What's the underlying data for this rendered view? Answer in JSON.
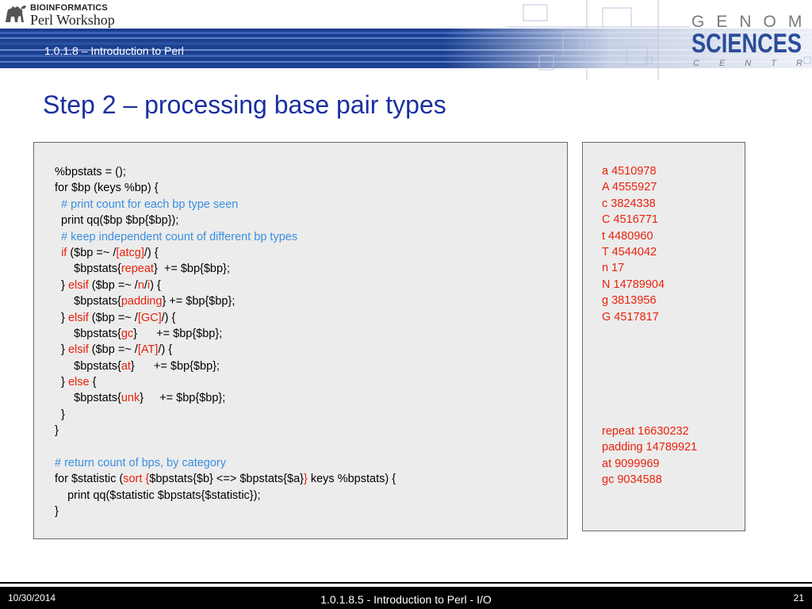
{
  "header": {
    "logo_top": "BIOINFORMATICS",
    "logo_bottom": "Perl Workshop",
    "section_title": "1.0.1.8 – Introduction to Perl",
    "gsc_line1": "GENOME",
    "gsc_line2": "SCIENCES",
    "gsc_line3": "CENTRE"
  },
  "slide": {
    "title": "Step 2 – processing base pair types"
  },
  "code": {
    "lines": [
      [
        {
          "t": "%bpstats = ();",
          "c": "n"
        }
      ],
      [
        {
          "t": "for $bp (keys %bp) {",
          "c": "n"
        }
      ],
      [
        {
          "t": "  # print count for each bp type seen",
          "c": "cm"
        }
      ],
      [
        {
          "t": "  print qq($bp $bp{$bp});",
          "c": "n"
        }
      ],
      [
        {
          "t": "  # keep independent count of different bp types",
          "c": "cm"
        }
      ],
      [
        {
          "t": "  ",
          "c": "n"
        },
        {
          "t": "if",
          "c": "kw"
        },
        {
          "t": " ($bp =~ /",
          "c": "n"
        },
        {
          "t": "[atcg]",
          "c": "kw"
        },
        {
          "t": "/) {",
          "c": "n"
        }
      ],
      [
        {
          "t": "      $bpstats{",
          "c": "n"
        },
        {
          "t": "repeat",
          "c": "kw"
        },
        {
          "t": "}  += $bp{$bp};",
          "c": "n"
        }
      ],
      [
        {
          "t": "  } ",
          "c": "n"
        },
        {
          "t": "elsif",
          "c": "kw"
        },
        {
          "t": " ($bp =~ /",
          "c": "n"
        },
        {
          "t": "n",
          "c": "kw"
        },
        {
          "t": "/",
          "c": "n"
        },
        {
          "t": "i",
          "c": "kw"
        },
        {
          "t": ") {",
          "c": "n"
        }
      ],
      [
        {
          "t": "      $bpstats{",
          "c": "n"
        },
        {
          "t": "padding",
          "c": "kw"
        },
        {
          "t": "} += $bp{$bp};",
          "c": "n"
        }
      ],
      [
        {
          "t": "  } ",
          "c": "n"
        },
        {
          "t": "elsif",
          "c": "kw"
        },
        {
          "t": " ($bp =~ /",
          "c": "n"
        },
        {
          "t": "[GC]",
          "c": "kw"
        },
        {
          "t": "/) {",
          "c": "n"
        }
      ],
      [
        {
          "t": "      $bpstats{",
          "c": "n"
        },
        {
          "t": "gc",
          "c": "kw"
        },
        {
          "t": "}      += $bp{$bp};",
          "c": "n"
        }
      ],
      [
        {
          "t": "  } ",
          "c": "n"
        },
        {
          "t": "elsif",
          "c": "kw"
        },
        {
          "t": " ($bp =~ /",
          "c": "n"
        },
        {
          "t": "[AT]",
          "c": "kw"
        },
        {
          "t": "/) {",
          "c": "n"
        }
      ],
      [
        {
          "t": "      $bpstats{",
          "c": "n"
        },
        {
          "t": "at",
          "c": "kw"
        },
        {
          "t": "}      += $bp{$bp};",
          "c": "n"
        }
      ],
      [
        {
          "t": "  } ",
          "c": "n"
        },
        {
          "t": "else",
          "c": "kw"
        },
        {
          "t": " {",
          "c": "n"
        }
      ],
      [
        {
          "t": "      $bpstats{",
          "c": "n"
        },
        {
          "t": "unk",
          "c": "kw"
        },
        {
          "t": "}     += $bp{$bp};",
          "c": "n"
        }
      ],
      [
        {
          "t": "  }",
          "c": "n"
        }
      ],
      [
        {
          "t": "}",
          "c": "n"
        }
      ],
      [
        {
          "t": "",
          "c": "n"
        }
      ],
      [
        {
          "t": "# return count of bps, by category",
          "c": "cm"
        }
      ],
      [
        {
          "t": "for $statistic (",
          "c": "n"
        },
        {
          "t": "sort {",
          "c": "kw"
        },
        {
          "t": "$bpstats{$b} <=> $bpstats{$a}",
          "c": "n"
        },
        {
          "t": "}",
          "c": "kw"
        },
        {
          "t": " keys %bpstats) {",
          "c": "n"
        }
      ],
      [
        {
          "t": "    print qq($statistic $bpstats{$statistic});",
          "c": "n"
        }
      ],
      [
        {
          "t": "}",
          "c": "n"
        }
      ]
    ]
  },
  "output": {
    "counts": [
      "a 4510978",
      "A 4555927",
      "c 3824338",
      "C 4516771",
      "t 4480960",
      "T 4544042",
      "n 17",
      "N 14789904",
      "g 3813956",
      "G 4517817"
    ],
    "categories": [
      "repeat 16630232",
      "padding 14789921",
      "at 9099969",
      "gc 9034588"
    ]
  },
  "footer": {
    "date": "10/30/2014",
    "title": "1.0.1.8.5 - Introduction to Perl - I/O",
    "page": "21"
  }
}
